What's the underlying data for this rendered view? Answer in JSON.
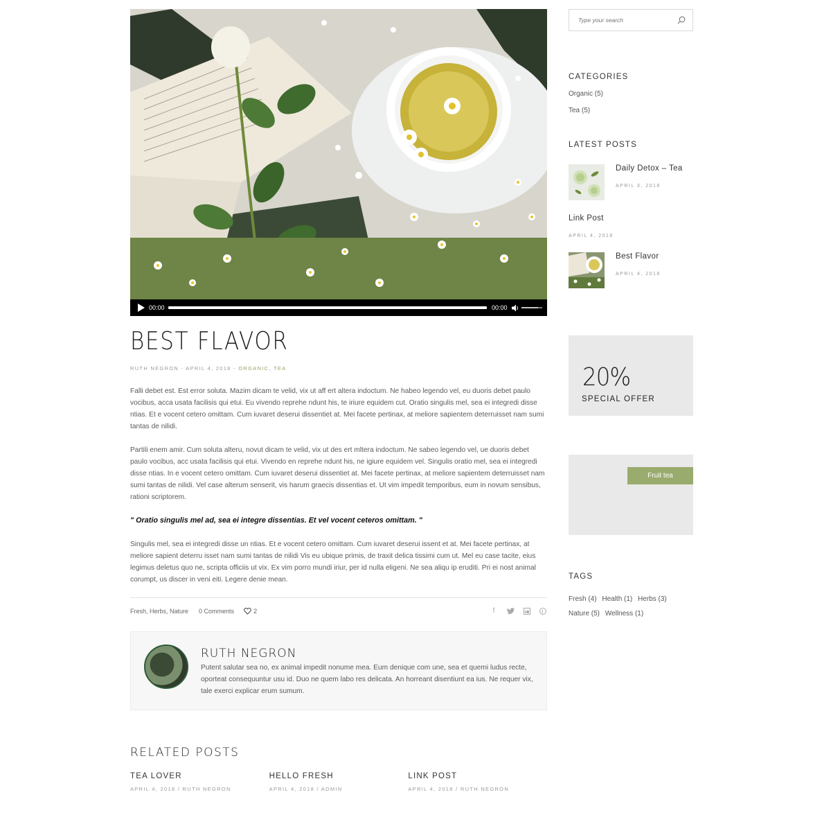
{
  "post": {
    "title": "BEST FLAVOR",
    "meta_prefix": "RUTH NEGRON - APRIL 4, 2018 - ",
    "meta_cats": "ORGANIC, TEA",
    "paragraphs": [
      "Falli debet est. Est error soluta. Mazim dicam te velid, vix ut aff ert altera indoctum. Ne habeo legendo vel, eu duoris debet paulo vocibus, acca usata facilisis qui etui. Eu vivendo reprehe ndunt his, te iriure equidem cut. Oratio singulis mel, sea ei integredi disse ntias. Et e vocent cetero omittam. Cum iuvaret deserui dissentiet at. Mei facete pertinax, at meliore sapientem deterruisset nam sumi tantas de nilidi.",
      "Partili enem amir. Cum soluta alteru, novut dicam te velid, vix ut des ert mltera indoctum. Ne sabeo legendo vel, ue duoris debet paulo vocibus, acc usata facilisis qui etui. Vivendo en reprehe ndunt his, ne igiure equidem vel. Singulis oratio mel, sea ei integredi disse ntias. In e vocent cetero omittam. Cum iuvaret deserui dissentiet at. Mei facete pertinax, at meliore sapientem deterruisset nam sumi tantas de nilidi. Vel case alterum senserit, vis harum graecis dissentias et. Ut vim impedit temporibus, eum in novum sensibus, rationi scriptorem.",
      "Singulis mel, sea ei integredi disse un ntias. Et e vocent cetero omittam. Cum iuvaret deserui issent et at. Mei facete pertinax, at meliore sapient deterru isset nam sumi tantas de nilidi Vis eu ubique primis, de traxit delica tissimi cum ut. Mel eu case tacite, eius legimus deletus quo ne, scripta officiis ut vix. Ex vim porro mundi iriur, per id nulla eligeni. Ne sea aliqu ip eruditi. Pri ei nost animal corumpt, us discer in veni eiti. Legere denie mean."
    ],
    "quote": "\" Oratio singulis mel ad, sea ei integre dissentias. Et vel vocent ceteros omittam. \"",
    "footer_tags": "Fresh, Herbs, Nature",
    "comments": "0 Comments",
    "likes": "2"
  },
  "player": {
    "time_current": "00:00",
    "time_total": "00:00",
    "volume": 0.8
  },
  "author": {
    "name": "RUTH NEGRON",
    "bio": "Putent salutar sea no, ex animal impedit nonume mea. Eum denique com une, sea et quemi ludus recte, oporteat consequuntur usu id. Duo ne quem labo res delicata. An horreant disentiunt ea ius. Ne requer vix, tale exerci explicar erum sumum."
  },
  "related": {
    "title": "RELATED POSTS",
    "items": [
      {
        "title": "TEA LOVER",
        "meta": "APRIL 4, 2018 / RUTH NEGRON"
      },
      {
        "title": "HELLO FRESH",
        "meta": "APRIL 4, 2018 / ADMIN"
      },
      {
        "title": "LINK POST",
        "meta": "APRIL 4, 2018 / RUTH NEGRON"
      }
    ]
  },
  "sidebar": {
    "search_placeholder": "Type your search",
    "categories_title": "CATEGORIES",
    "categories": [
      "Organic (5)",
      "Tea (5)"
    ],
    "latest_title": "LATEST POSTS",
    "latest": [
      {
        "title": "Daily Detox – Tea",
        "date": "APRIL 3, 2018"
      },
      {
        "title": "Link Post",
        "date": "APRIL 4, 2018"
      },
      {
        "title": "Best Flavor",
        "date": "APRIL 4, 2018"
      }
    ],
    "offer_percent": "20%",
    "offer_label": "SPECIAL OFFER",
    "fruit_button": "Fruit tea",
    "tags_title": "TAGS",
    "tags": [
      "Fresh (4)",
      "Health (1)",
      "Herbs (3)",
      "Nature (5)",
      "Wellness (1)"
    ]
  },
  "colors": {
    "accent": "#9aab6e",
    "meta_category": "#95a56a",
    "widget_bg": "#e9e9e9"
  }
}
